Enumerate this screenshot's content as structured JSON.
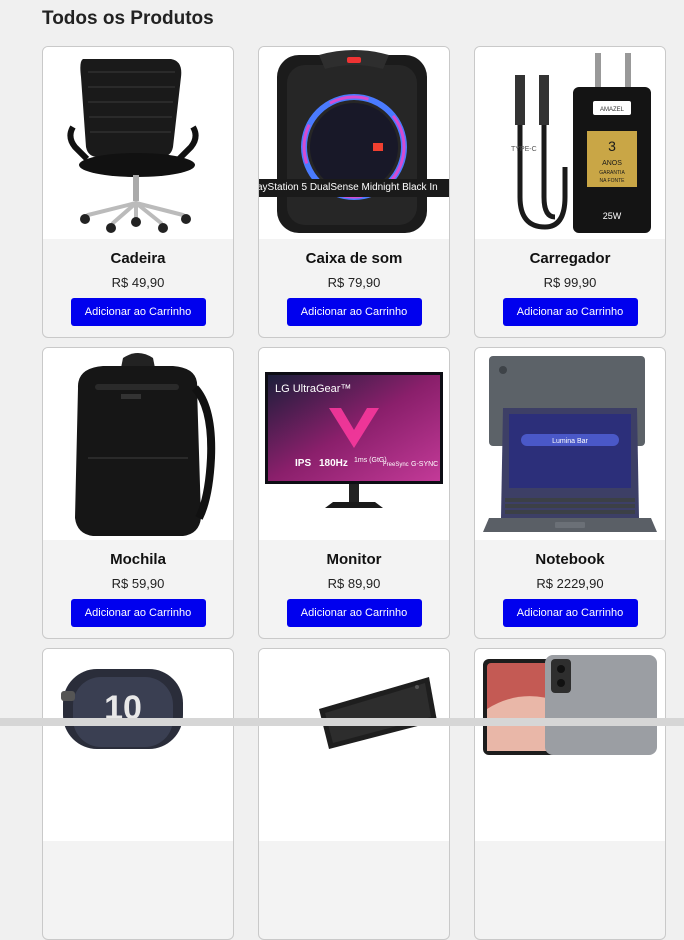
{
  "page": {
    "title": "Todos os Produtos"
  },
  "products": [
    {
      "name": "Cadeira",
      "price": "R$ 49,90",
      "button": "Adicionar ao Carrinho",
      "image_icon": "office-chair-icon"
    },
    {
      "name": "Caixa de som",
      "price": "R$ 79,90",
      "button": "Adicionar ao Carrinho",
      "image_icon": "speaker-icon",
      "image_caption": "ayStation 5 DualSense Midnight Black In"
    },
    {
      "name": "Carregador",
      "price": "R$ 99,90",
      "button": "Adicionar ao Carrinho",
      "image_icon": "charger-icon",
      "badge_text": "3 ANOS GARANTIA NA FONTE",
      "wattage": "25W",
      "cable_label": "TYPE-C",
      "brand": "AMAZEL"
    },
    {
      "name": "Mochila",
      "price": "R$ 59,90",
      "button": "Adicionar ao Carrinho",
      "image_icon": "backpack-icon"
    },
    {
      "name": "Monitor",
      "price": "R$ 89,90",
      "button": "Adicionar ao Carrinho",
      "image_icon": "monitor-icon",
      "brand_text": "LG UltraGear™",
      "specs": [
        "IPS",
        "180Hz",
        "1ms (GtG)",
        "FreeSync",
        "G-SYNC"
      ]
    },
    {
      "name": "Notebook",
      "price": "R$ 2229,90",
      "button": "Adicionar ao Carrinho",
      "image_icon": "laptop-icon",
      "screen_text": "Lumina Bar"
    },
    {
      "image_icon": "smartwatch-icon",
      "watch_text": "10"
    },
    {
      "image_icon": "tablet-icon"
    },
    {
      "image_icon": "tablet-phone-icon"
    }
  ],
  "colors": {
    "button": "#0000ee",
    "card_bg": "#f3f3f3",
    "page_bg": "#f0f0f0"
  }
}
